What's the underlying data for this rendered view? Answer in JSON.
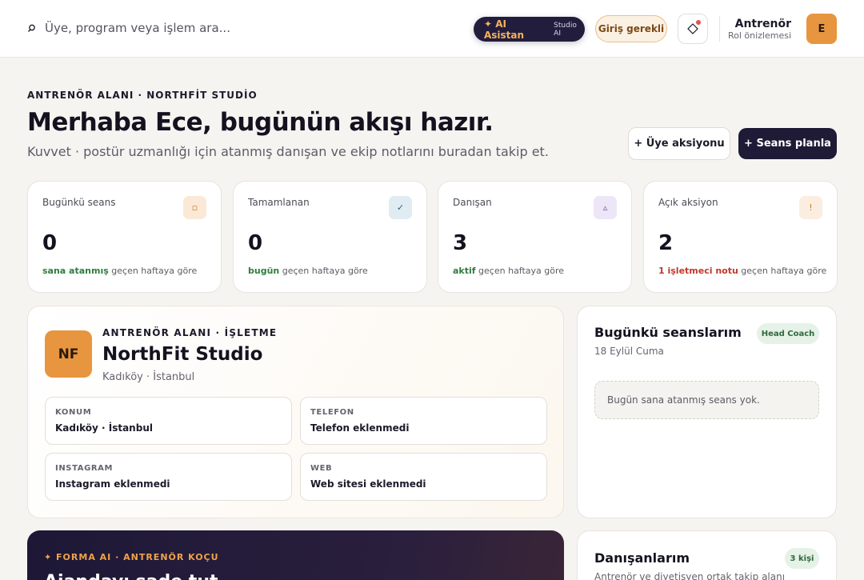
{
  "topbar": {
    "search_placeholder": "Üye, program veya işlem ara...",
    "ai_button": "✦ AI Asistan",
    "ai_button_sub": "Studio AI",
    "login_button": "Giriş gerekli",
    "user_role": "Antrenör",
    "user_sub": "Rol önizlemesi",
    "avatar_initial": "E",
    "icons": [
      "search-icon",
      "diamond-icon"
    ]
  },
  "header": {
    "eyebrow": "ANTRENÖR ALANI · NORTHFİT STUDİO",
    "title": "Merhaba Ece, bugünün akışı hazır.",
    "subtitle": "Kuvvet · postür uzmanlığı için atanmış danışan ve ekip notlarını buradan takip et.",
    "member_action_button": "+ Üye aksiyonu",
    "plan_session_button": "+ Seans planla"
  },
  "stats": [
    {
      "label": "Bugünkü seans",
      "value": "0",
      "highlight": "sana atanmış",
      "suffix": " geçen haftaya göre",
      "icon": "square-icon",
      "glyph": "▫",
      "badge_bg": "#fbe9d7",
      "badge_fg": "#c9782c",
      "highlight_color": "#2e7d3e"
    },
    {
      "label": "Tamamlanan",
      "value": "0",
      "highlight": "bugün",
      "suffix": " geçen haftaya göre",
      "icon": "check-icon",
      "glyph": "✓",
      "badge_bg": "#e0ecf2",
      "badge_fg": "#2f5e78",
      "highlight_color": "#2e7d3e"
    },
    {
      "label": "Danışan",
      "value": "3",
      "highlight": "aktif",
      "suffix": " geçen haftaya göre",
      "icon": "triangle-icon",
      "glyph": "▵",
      "badge_bg": "#ece6f7",
      "badge_fg": "#6a55a8",
      "highlight_color": "#2e7d3e"
    },
    {
      "label": "Açık aksiyon",
      "value": "2",
      "highlight": "1 işletmeci notu",
      "suffix": " geçen haftaya göre",
      "icon": "alert-icon",
      "glyph": "!",
      "badge_bg": "#fbeee0",
      "badge_fg": "#c9782c",
      "highlight_color": "#c0392b"
    }
  ],
  "business": {
    "logo": "NF",
    "eyebrow": "ANTRENÖR ALANI · İŞLETME",
    "name": "NorthFit Studio",
    "location": "Kadıköy · İstanbul",
    "fields": [
      {
        "label": "KONUM",
        "value": "Kadıköy · İstanbul"
      },
      {
        "label": "TELEFON",
        "value": "Telefon eklenmedi"
      },
      {
        "label": "INSTAGRAM",
        "value": "Instagram eklenmedi"
      },
      {
        "label": "WEB",
        "value": "Web sitesi eklenmedi"
      }
    ]
  },
  "sessions": {
    "title": "Bugünkü seanslarım",
    "date": "18 Eylül Cuma",
    "badge": "Head Coach",
    "empty": "Bugün sana atanmış seans yok."
  },
  "coach": {
    "eyebrow": "✦ FORMA AI · ANTRENÖR KOÇU",
    "title": "Ajandayı sade tut..."
  },
  "clients": {
    "title": "Danışanlarım",
    "badge": "3 kişi",
    "subtitle": "Antrenör ve diyetisyen ortak takip alanı"
  }
}
